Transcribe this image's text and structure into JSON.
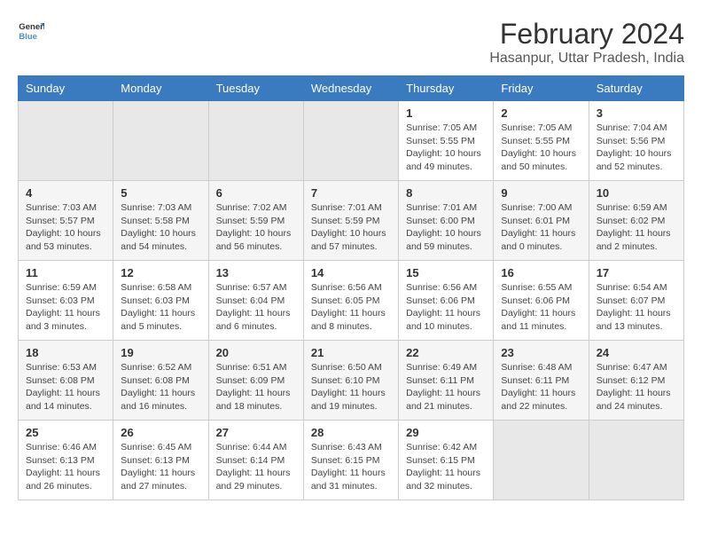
{
  "header": {
    "logo_line1": "General",
    "logo_line2": "Blue",
    "title": "February 2024",
    "subtitle": "Hasanpur, Uttar Pradesh, India"
  },
  "days_of_week": [
    "Sunday",
    "Monday",
    "Tuesday",
    "Wednesday",
    "Thursday",
    "Friday",
    "Saturday"
  ],
  "weeks": [
    {
      "days": [
        {
          "num": "",
          "info": ""
        },
        {
          "num": "",
          "info": ""
        },
        {
          "num": "",
          "info": ""
        },
        {
          "num": "",
          "info": ""
        },
        {
          "num": "1",
          "info": "Sunrise: 7:05 AM\nSunset: 5:55 PM\nDaylight: 10 hours\nand 49 minutes."
        },
        {
          "num": "2",
          "info": "Sunrise: 7:05 AM\nSunset: 5:55 PM\nDaylight: 10 hours\nand 50 minutes."
        },
        {
          "num": "3",
          "info": "Sunrise: 7:04 AM\nSunset: 5:56 PM\nDaylight: 10 hours\nand 52 minutes."
        }
      ]
    },
    {
      "days": [
        {
          "num": "4",
          "info": "Sunrise: 7:03 AM\nSunset: 5:57 PM\nDaylight: 10 hours\nand 53 minutes."
        },
        {
          "num": "5",
          "info": "Sunrise: 7:03 AM\nSunset: 5:58 PM\nDaylight: 10 hours\nand 54 minutes."
        },
        {
          "num": "6",
          "info": "Sunrise: 7:02 AM\nSunset: 5:59 PM\nDaylight: 10 hours\nand 56 minutes."
        },
        {
          "num": "7",
          "info": "Sunrise: 7:01 AM\nSunset: 5:59 PM\nDaylight: 10 hours\nand 57 minutes."
        },
        {
          "num": "8",
          "info": "Sunrise: 7:01 AM\nSunset: 6:00 PM\nDaylight: 10 hours\nand 59 minutes."
        },
        {
          "num": "9",
          "info": "Sunrise: 7:00 AM\nSunset: 6:01 PM\nDaylight: 11 hours\nand 0 minutes."
        },
        {
          "num": "10",
          "info": "Sunrise: 6:59 AM\nSunset: 6:02 PM\nDaylight: 11 hours\nand 2 minutes."
        }
      ]
    },
    {
      "days": [
        {
          "num": "11",
          "info": "Sunrise: 6:59 AM\nSunset: 6:03 PM\nDaylight: 11 hours\nand 3 minutes."
        },
        {
          "num": "12",
          "info": "Sunrise: 6:58 AM\nSunset: 6:03 PM\nDaylight: 11 hours\nand 5 minutes."
        },
        {
          "num": "13",
          "info": "Sunrise: 6:57 AM\nSunset: 6:04 PM\nDaylight: 11 hours\nand 6 minutes."
        },
        {
          "num": "14",
          "info": "Sunrise: 6:56 AM\nSunset: 6:05 PM\nDaylight: 11 hours\nand 8 minutes."
        },
        {
          "num": "15",
          "info": "Sunrise: 6:56 AM\nSunset: 6:06 PM\nDaylight: 11 hours\nand 10 minutes."
        },
        {
          "num": "16",
          "info": "Sunrise: 6:55 AM\nSunset: 6:06 PM\nDaylight: 11 hours\nand 11 minutes."
        },
        {
          "num": "17",
          "info": "Sunrise: 6:54 AM\nSunset: 6:07 PM\nDaylight: 11 hours\nand 13 minutes."
        }
      ]
    },
    {
      "days": [
        {
          "num": "18",
          "info": "Sunrise: 6:53 AM\nSunset: 6:08 PM\nDaylight: 11 hours\nand 14 minutes."
        },
        {
          "num": "19",
          "info": "Sunrise: 6:52 AM\nSunset: 6:08 PM\nDaylight: 11 hours\nand 16 minutes."
        },
        {
          "num": "20",
          "info": "Sunrise: 6:51 AM\nSunset: 6:09 PM\nDaylight: 11 hours\nand 18 minutes."
        },
        {
          "num": "21",
          "info": "Sunrise: 6:50 AM\nSunset: 6:10 PM\nDaylight: 11 hours\nand 19 minutes."
        },
        {
          "num": "22",
          "info": "Sunrise: 6:49 AM\nSunset: 6:11 PM\nDaylight: 11 hours\nand 21 minutes."
        },
        {
          "num": "23",
          "info": "Sunrise: 6:48 AM\nSunset: 6:11 PM\nDaylight: 11 hours\nand 22 minutes."
        },
        {
          "num": "24",
          "info": "Sunrise: 6:47 AM\nSunset: 6:12 PM\nDaylight: 11 hours\nand 24 minutes."
        }
      ]
    },
    {
      "days": [
        {
          "num": "25",
          "info": "Sunrise: 6:46 AM\nSunset: 6:13 PM\nDaylight: 11 hours\nand 26 minutes."
        },
        {
          "num": "26",
          "info": "Sunrise: 6:45 AM\nSunset: 6:13 PM\nDaylight: 11 hours\nand 27 minutes."
        },
        {
          "num": "27",
          "info": "Sunrise: 6:44 AM\nSunset: 6:14 PM\nDaylight: 11 hours\nand 29 minutes."
        },
        {
          "num": "28",
          "info": "Sunrise: 6:43 AM\nSunset: 6:15 PM\nDaylight: 11 hours\nand 31 minutes."
        },
        {
          "num": "29",
          "info": "Sunrise: 6:42 AM\nSunset: 6:15 PM\nDaylight: 11 hours\nand 32 minutes."
        },
        {
          "num": "",
          "info": ""
        },
        {
          "num": "",
          "info": ""
        }
      ]
    }
  ]
}
